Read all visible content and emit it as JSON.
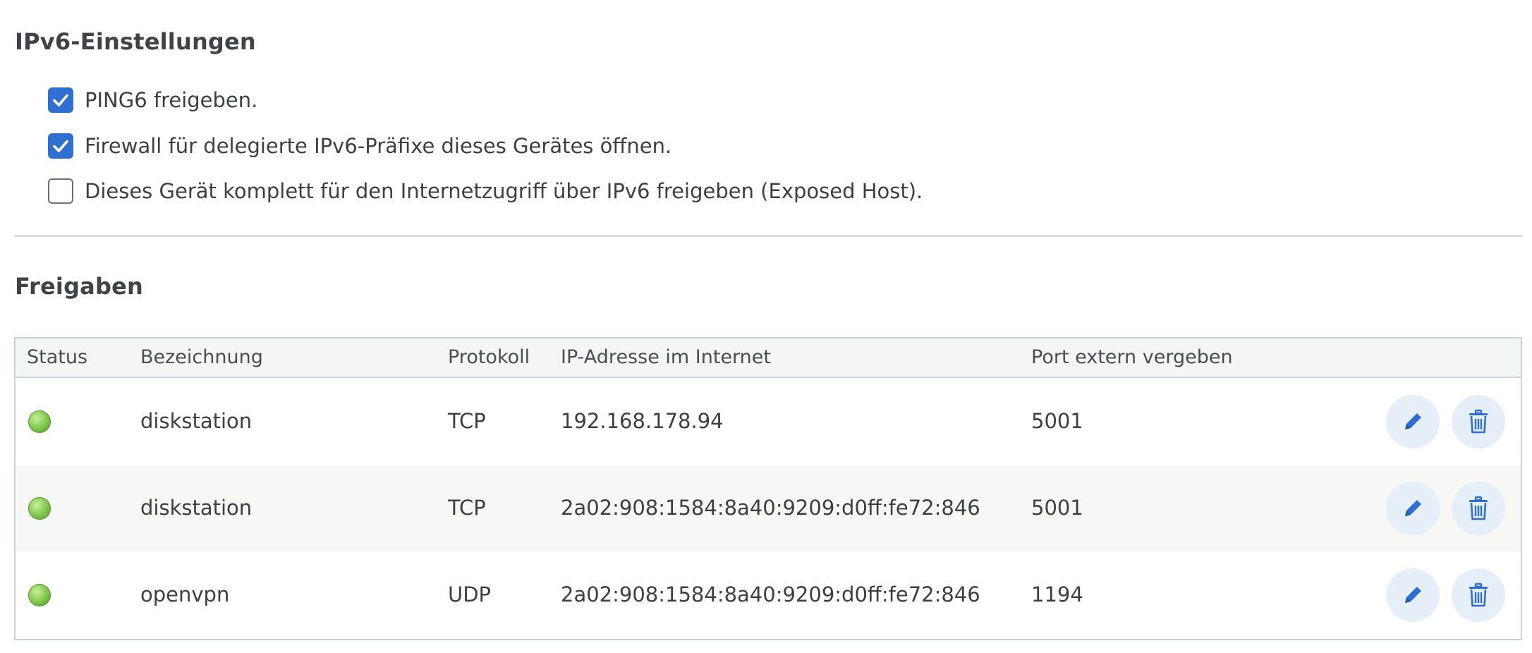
{
  "ipv6_settings": {
    "title": "IPv6-Einstellungen",
    "options": [
      {
        "label": "PING6 freigeben.",
        "checked": true
      },
      {
        "label": "Firewall für delegierte IPv6-Präfixe dieses Gerätes öffnen.",
        "checked": true
      },
      {
        "label": "Dieses Gerät komplett für den Internetzugriff über IPv6 freigeben (Exposed Host).",
        "checked": false
      }
    ]
  },
  "freigaben": {
    "title": "Freigaben",
    "columns": {
      "status": "Status",
      "name": "Bezeichnung",
      "protocol": "Protokoll",
      "ip": "IP-Adresse im Internet",
      "port": "Port extern vergeben"
    },
    "rows": [
      {
        "status": "active",
        "name": "diskstation",
        "protocol": "TCP",
        "ip": "192.168.178.94",
        "port": "5001"
      },
      {
        "status": "active",
        "name": "diskstation",
        "protocol": "TCP",
        "ip": "2a02:908:1584:8a40:9209:d0ff:fe72:846",
        "port": "5001"
      },
      {
        "status": "active",
        "name": "openvpn",
        "protocol": "UDP",
        "ip": "2a02:908:1584:8a40:9209:d0ff:fe72:846",
        "port": "1194"
      }
    ]
  },
  "icons": {
    "edit": "pencil-icon",
    "delete": "trash-icon",
    "status": "status-led-icon",
    "check": "checkmark-icon"
  },
  "colors": {
    "accent": "#2f6fd1",
    "status_ok": "#7cc24a",
    "action_bg": "#e6eef8",
    "table_border": "#c8d3da"
  }
}
